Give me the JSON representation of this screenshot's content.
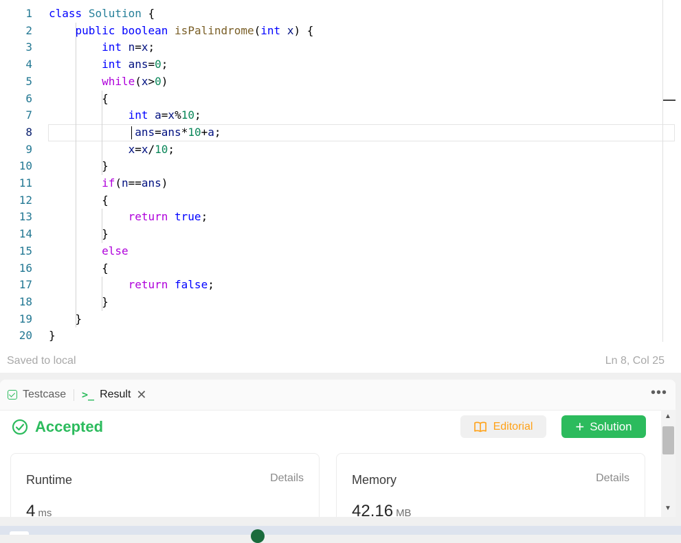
{
  "editor": {
    "lines": [
      {
        "n": "1",
        "tokens": [
          [
            "k",
            "class"
          ],
          [
            "op",
            " "
          ],
          [
            "ty",
            "Solution"
          ],
          [
            "op",
            " {"
          ]
        ]
      },
      {
        "n": "2",
        "tokens": [
          [
            "op",
            "    "
          ],
          [
            "k",
            "public"
          ],
          [
            "op",
            " "
          ],
          [
            "k",
            "boolean"
          ],
          [
            "op",
            " "
          ],
          [
            "fn",
            "isPalindrome"
          ],
          [
            "op",
            "("
          ],
          [
            "k",
            "int"
          ],
          [
            "op",
            " "
          ],
          [
            "var",
            "x"
          ],
          [
            "op",
            ") {"
          ]
        ]
      },
      {
        "n": "3",
        "tokens": [
          [
            "op",
            "        "
          ],
          [
            "k",
            "int"
          ],
          [
            "op",
            " "
          ],
          [
            "var",
            "n"
          ],
          [
            "op",
            "="
          ],
          [
            "var",
            "x"
          ],
          [
            "op",
            ";"
          ]
        ]
      },
      {
        "n": "4",
        "tokens": [
          [
            "op",
            "        "
          ],
          [
            "k",
            "int"
          ],
          [
            "op",
            " "
          ],
          [
            "var",
            "ans"
          ],
          [
            "op",
            "="
          ],
          [
            "num",
            "0"
          ],
          [
            "op",
            ";"
          ]
        ]
      },
      {
        "n": "5",
        "tokens": [
          [
            "op",
            "        "
          ],
          [
            "ctl",
            "while"
          ],
          [
            "op",
            "("
          ],
          [
            "var",
            "x"
          ],
          [
            "op",
            ">"
          ],
          [
            "num",
            "0"
          ],
          [
            "op",
            ")"
          ]
        ]
      },
      {
        "n": "6",
        "tokens": [
          [
            "op",
            "        {"
          ]
        ]
      },
      {
        "n": "7",
        "tokens": [
          [
            "op",
            "            "
          ],
          [
            "k",
            "int"
          ],
          [
            "op",
            " "
          ],
          [
            "var",
            "a"
          ],
          [
            "op",
            "="
          ],
          [
            "var",
            "x"
          ],
          [
            "op",
            "%"
          ],
          [
            "num",
            "10"
          ],
          [
            "op",
            ";"
          ]
        ]
      },
      {
        "n": "8",
        "tokens": [
          [
            "op",
            "             "
          ],
          [
            "var",
            "ans"
          ],
          [
            "op",
            "="
          ],
          [
            "var",
            "ans"
          ],
          [
            "op",
            "*"
          ],
          [
            "num",
            "10"
          ],
          [
            "op",
            "+"
          ],
          [
            "var",
            "a"
          ],
          [
            "op",
            ";"
          ]
        ]
      },
      {
        "n": "9",
        "tokens": [
          [
            "op",
            "            "
          ],
          [
            "var",
            "x"
          ],
          [
            "op",
            "="
          ],
          [
            "var",
            "x"
          ],
          [
            "op",
            "/"
          ],
          [
            "num",
            "10"
          ],
          [
            "op",
            ";"
          ]
        ]
      },
      {
        "n": "10",
        "tokens": [
          [
            "op",
            "        }"
          ]
        ]
      },
      {
        "n": "11",
        "tokens": [
          [
            "op",
            "        "
          ],
          [
            "ctl",
            "if"
          ],
          [
            "op",
            "("
          ],
          [
            "var",
            "n"
          ],
          [
            "op",
            "=="
          ],
          [
            "var",
            "ans"
          ],
          [
            "op",
            ")"
          ]
        ]
      },
      {
        "n": "12",
        "tokens": [
          [
            "op",
            "        {"
          ]
        ]
      },
      {
        "n": "13",
        "tokens": [
          [
            "op",
            "            "
          ],
          [
            "ctl",
            "return"
          ],
          [
            "op",
            " "
          ],
          [
            "k",
            "true"
          ],
          [
            "op",
            ";"
          ]
        ]
      },
      {
        "n": "14",
        "tokens": [
          [
            "op",
            "        }"
          ]
        ]
      },
      {
        "n": "15",
        "tokens": [
          [
            "op",
            "        "
          ],
          [
            "ctl",
            "else"
          ]
        ]
      },
      {
        "n": "16",
        "tokens": [
          [
            "op",
            "        {"
          ]
        ]
      },
      {
        "n": "17",
        "tokens": [
          [
            "op",
            "            "
          ],
          [
            "ctl",
            "return"
          ],
          [
            "op",
            " "
          ],
          [
            "k",
            "false"
          ],
          [
            "op",
            ";"
          ]
        ]
      },
      {
        "n": "18",
        "tokens": [
          [
            "op",
            "        }"
          ]
        ]
      },
      {
        "n": "19",
        "tokens": [
          [
            "op",
            "    }"
          ]
        ]
      },
      {
        "n": "20",
        "tokens": [
          [
            "op",
            "}"
          ]
        ]
      }
    ],
    "active_line": 8,
    "status_saved": "Saved to local",
    "status_position": "Ln 8, Col 25"
  },
  "panel": {
    "tabs": {
      "testcase": "Testcase",
      "result": "Result"
    },
    "result_status": "Accepted",
    "editorial_label": "Editorial",
    "solution_label": "Solution",
    "runtime": {
      "title": "Runtime",
      "details": "Details",
      "value": "4",
      "unit": "ms"
    },
    "memory": {
      "title": "Memory",
      "details": "Details",
      "value": "42.16",
      "unit": "MB"
    }
  },
  "icons": {
    "testcase": "check-box-icon",
    "result": "terminal-icon",
    "close": "close-icon",
    "more": "more-icon",
    "accepted": "check-circle-icon",
    "editorial": "book-icon",
    "solution": "plus-icon"
  },
  "colors": {
    "accent_green": "#2cbb5d",
    "editorial_orange": "#ffa116"
  }
}
